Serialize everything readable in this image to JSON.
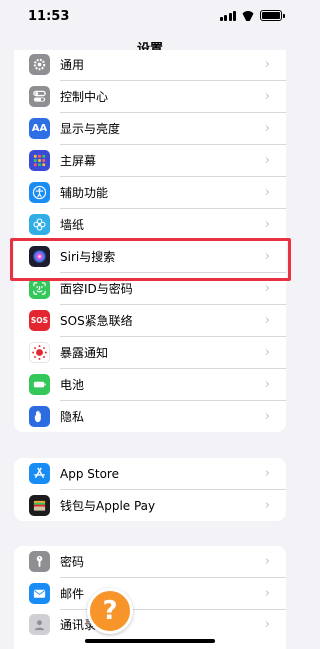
{
  "status_bar": {
    "time": "11:53"
  },
  "header": {
    "title": "设置"
  },
  "groups": [
    {
      "items": [
        {
          "label": "通用",
          "icon": "gear-icon",
          "color": "#8e8e93"
        },
        {
          "label": "控制中心",
          "icon": "toggles-icon",
          "color": "#8e8e93"
        },
        {
          "label": "显示与亮度",
          "icon": "display-aa-icon",
          "color": "#2f6fe6",
          "glyph": "AA"
        },
        {
          "label": "主屏幕",
          "icon": "home-grid-icon",
          "color": "#3b4bd8"
        },
        {
          "label": "辅助功能",
          "icon": "accessibility-icon",
          "color": "#1a8df5"
        },
        {
          "label": "墙纸",
          "icon": "flower-icon",
          "color": "#31aee6"
        },
        {
          "label": "Siri与搜索",
          "icon": "siri-icon",
          "color": "#1c1c2e"
        },
        {
          "label": "面容ID与密码",
          "icon": "face-id-icon",
          "color": "#34c759"
        },
        {
          "label": "SOS紧急联络",
          "icon": "sos-icon",
          "color": "#e3262f",
          "glyph": "SOS"
        },
        {
          "label": "暴露通知",
          "icon": "exposure-icon",
          "color": "#ffffff"
        },
        {
          "label": "电池",
          "icon": "battery-icon",
          "color": "#34c759"
        },
        {
          "label": "隐私",
          "icon": "hand-icon",
          "color": "#2d6be0"
        }
      ]
    },
    {
      "items": [
        {
          "label": "App Store",
          "icon": "app-store-icon",
          "color": "#1a8df5"
        },
        {
          "label": "钱包与Apple Pay",
          "icon": "wallet-icon",
          "color": "#1c1c1e"
        }
      ]
    },
    {
      "items": [
        {
          "label": "密码",
          "icon": "key-icon",
          "color": "#8e8e93"
        },
        {
          "label": "邮件",
          "icon": "mail-icon",
          "color": "#1a8df5"
        },
        {
          "label": "通讯录",
          "icon": "contacts-icon",
          "color": "#d0d0d4"
        }
      ]
    }
  ],
  "overlay": {
    "help_glyph": "?"
  },
  "highlight_color": "#e8323f"
}
